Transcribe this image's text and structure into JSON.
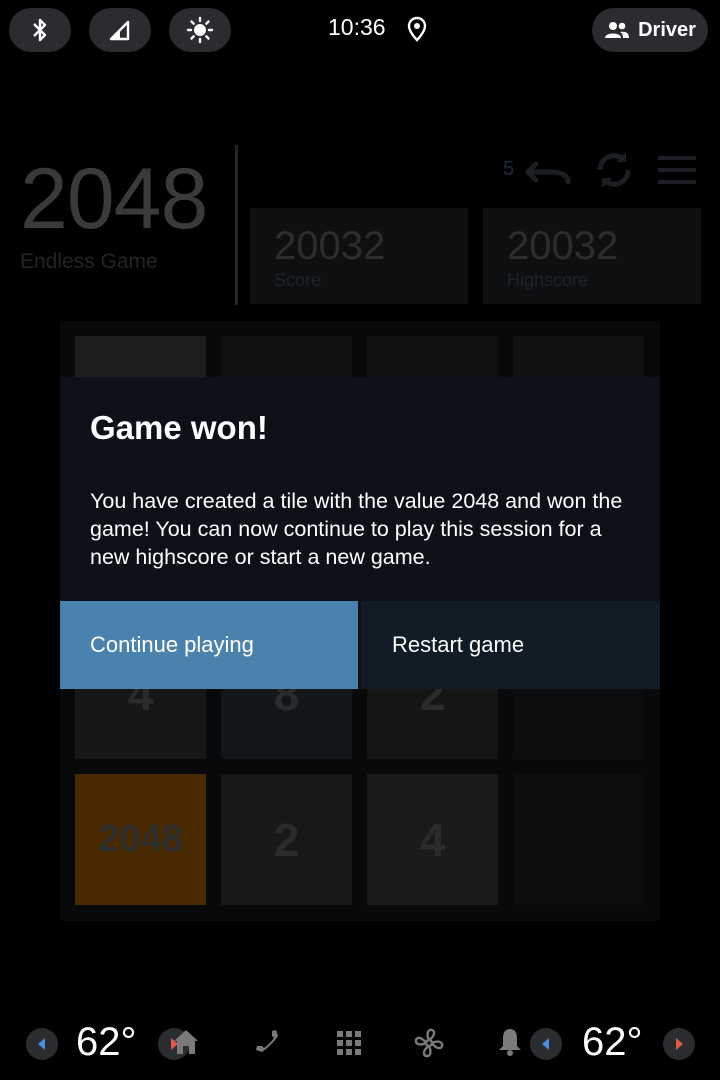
{
  "status_bar": {
    "time": "10:36",
    "icons": [
      "bluetooth-icon",
      "cell-signal-icon",
      "brightness-icon",
      "location-pin-icon"
    ],
    "profile_label": "Driver"
  },
  "game": {
    "title": "2048",
    "subtitle": "Endless Game",
    "undo_count": "5",
    "score": {
      "value": "20032",
      "label": "Score"
    },
    "highscore": {
      "value": "20032",
      "label": "Highscore"
    },
    "header_icons": [
      "undo-icon",
      "restart-icon",
      "menu-icon"
    ],
    "board_rows": [
      [
        "",
        "",
        "",
        ""
      ],
      [
        "",
        "",
        "",
        ""
      ],
      [
        "4",
        "8",
        "2",
        ""
      ],
      [
        "2048",
        "2",
        "4",
        ""
      ]
    ]
  },
  "dialog": {
    "title": "Game won!",
    "message": "You have created a tile with the value 2048 and won the game! You can now continue to play this session for a new highscore or start a new game.",
    "continue_label": "Continue playing",
    "restart_label": "Restart game"
  },
  "bottom_bar": {
    "left_temp": "62°",
    "right_temp": "62°",
    "icons": [
      "home-icon",
      "phone-icon",
      "apps-grid-icon",
      "fan-icon",
      "bell-icon"
    ]
  },
  "colors": {
    "primary_button": "#4b82ad",
    "secondary_button": "#111c27",
    "dialog_bg": "#0b1116",
    "tile_2048": "#4a2a00"
  }
}
